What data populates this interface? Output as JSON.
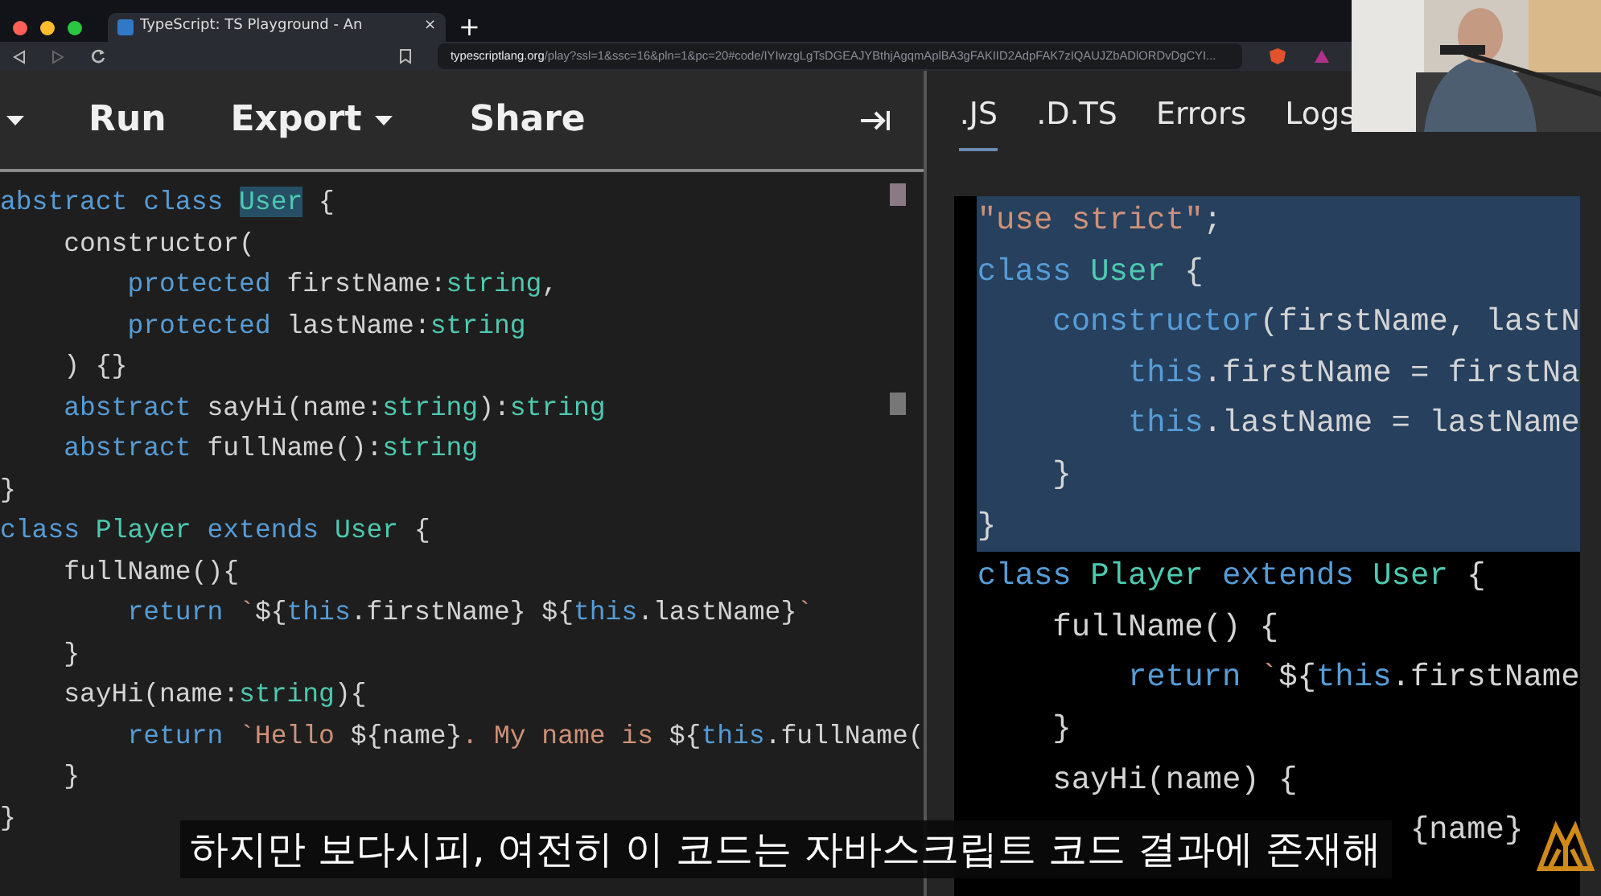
{
  "browser": {
    "tab_title": "TypeScript: TS Playground - An",
    "tab_close": "×",
    "new_tab": "+",
    "url_host": "typescriptlang.org",
    "url_path": "/play?ssl=1&ssc=16&pln=1&pc=20#code/IYIwzgLgTsDGEAJYBthjAgqmAplBA3gFAKIID2AdpFAK7zIQAUJZbADlORDvDgCYI..."
  },
  "toolbar": {
    "items": [
      {
        "kind": "caret"
      },
      {
        "kind": "text",
        "label": "Run"
      },
      {
        "kind": "dropdown",
        "label": "Export"
      },
      {
        "kind": "text",
        "label": "Share"
      }
    ]
  },
  "editor_lines": [
    {
      "tokens": [
        {
          "kind": "kw",
          "text": "abstract class "
        },
        {
          "kind": "match",
          "text": "User"
        },
        {
          "kind": "plain",
          "text": " {"
        }
      ]
    },
    {
      "tokens": [
        {
          "kind": "plain",
          "text": "    constructor("
        }
      ]
    },
    {
      "tokens": [
        {
          "kind": "kw",
          "text": "        protected "
        },
        {
          "kind": "plain",
          "text": "firstName:"
        },
        {
          "kind": "type",
          "text": "string"
        },
        {
          "kind": "plain",
          "text": ","
        }
      ]
    },
    {
      "tokens": [
        {
          "kind": "kw",
          "text": "        protected "
        },
        {
          "kind": "plain",
          "text": "lastName:"
        },
        {
          "kind": "type",
          "text": "string"
        }
      ]
    },
    {
      "tokens": [
        {
          "kind": "plain",
          "text": "    ) {}"
        }
      ]
    },
    {
      "tokens": [
        {
          "kind": "kw",
          "text": "    abstract "
        },
        {
          "kind": "plain",
          "text": "sayHi(name:"
        },
        {
          "kind": "type",
          "text": "string"
        },
        {
          "kind": "plain",
          "text": "):"
        },
        {
          "kind": "type",
          "text": "string"
        }
      ]
    },
    {
      "tokens": [
        {
          "kind": "kw",
          "text": "    abstract "
        },
        {
          "kind": "plain",
          "text": "fullName():"
        },
        {
          "kind": "type",
          "text": "string"
        }
      ]
    },
    {
      "tokens": [
        {
          "kind": "plain",
          "text": "}"
        }
      ]
    },
    {
      "tokens": [
        {
          "kind": "kw",
          "text": "class "
        },
        {
          "kind": "type",
          "text": "Player "
        },
        {
          "kind": "kw",
          "text": "extends "
        },
        {
          "kind": "type",
          "text": "User"
        },
        {
          "kind": "plain",
          "text": " {"
        }
      ]
    },
    {
      "tokens": [
        {
          "kind": "plain",
          "text": "    fullName(){"
        }
      ]
    },
    {
      "tokens": [
        {
          "kind": "kw",
          "text": "        return "
        },
        {
          "kind": "str",
          "text": "`"
        },
        {
          "kind": "plain",
          "text": "${"
        },
        {
          "kind": "kw",
          "text": "this"
        },
        {
          "kind": "plain",
          "text": ".firstName} ${"
        },
        {
          "kind": "kw",
          "text": "this"
        },
        {
          "kind": "plain",
          "text": ".lastName}"
        },
        {
          "kind": "str",
          "text": "`"
        }
      ]
    },
    {
      "tokens": [
        {
          "kind": "plain",
          "text": "    }"
        }
      ]
    },
    {
      "tokens": [
        {
          "kind": "plain",
          "text": "    sayHi(name:"
        },
        {
          "kind": "type",
          "text": "string"
        },
        {
          "kind": "plain",
          "text": "){"
        }
      ]
    },
    {
      "tokens": [
        {
          "kind": "kw",
          "text": "        return "
        },
        {
          "kind": "str",
          "text": "`Hello "
        },
        {
          "kind": "plain",
          "text": "${name}"
        },
        {
          "kind": "str",
          "text": ". My name is "
        },
        {
          "kind": "plain",
          "text": "${"
        },
        {
          "kind": "kw",
          "text": "this"
        },
        {
          "kind": "plain",
          "text": ".fullName("
        }
      ]
    },
    {
      "tokens": [
        {
          "kind": "plain",
          "text": "    }"
        }
      ]
    },
    {
      "tokens": [
        {
          "kind": "plain",
          "text": "}"
        }
      ]
    }
  ],
  "output_tabs": [
    {
      "label": ".JS",
      "selected": true
    },
    {
      "label": ".D.TS",
      "selected": false
    },
    {
      "label": "Errors",
      "selected": false
    },
    {
      "label": "Logs",
      "selected": false
    }
  ],
  "output_lines": [
    {
      "selected": true,
      "tokens": [
        {
          "kind": "str",
          "text": "\"use strict\""
        },
        {
          "kind": "plain",
          "text": ";"
        }
      ]
    },
    {
      "selected": true,
      "tokens": [
        {
          "kind": "kw",
          "text": "class "
        },
        {
          "kind": "type",
          "text": "User"
        },
        {
          "kind": "plain",
          "text": " {"
        }
      ]
    },
    {
      "selected": true,
      "tokens": [
        {
          "kind": "kw",
          "text": "    constructor"
        },
        {
          "kind": "plain",
          "text": "(firstName, lastN"
        }
      ]
    },
    {
      "selected": true,
      "tokens": [
        {
          "kind": "kw",
          "text": "        this"
        },
        {
          "kind": "plain",
          "text": ".firstName = firstNa"
        }
      ]
    },
    {
      "selected": true,
      "tokens": [
        {
          "kind": "kw",
          "text": "        this"
        },
        {
          "kind": "plain",
          "text": ".lastName = lastName"
        }
      ]
    },
    {
      "selected": true,
      "tokens": [
        {
          "kind": "plain",
          "text": "    }"
        }
      ]
    },
    {
      "selected": true,
      "tokens": [
        {
          "kind": "plain",
          "text": "}"
        }
      ]
    },
    {
      "selected": false,
      "tokens": [
        {
          "kind": "kw",
          "text": "class "
        },
        {
          "kind": "type",
          "text": "Player "
        },
        {
          "kind": "kw",
          "text": "extends "
        },
        {
          "kind": "type",
          "text": "User"
        },
        {
          "kind": "plain",
          "text": " {"
        }
      ]
    },
    {
      "selected": false,
      "tokens": [
        {
          "kind": "plain",
          "text": "    fullName() {"
        }
      ]
    },
    {
      "selected": false,
      "tokens": [
        {
          "kind": "kw",
          "text": "        return "
        },
        {
          "kind": "str",
          "text": "`"
        },
        {
          "kind": "plain",
          "text": "${"
        },
        {
          "kind": "kw",
          "text": "this"
        },
        {
          "kind": "plain",
          "text": ".firstName"
        }
      ]
    },
    {
      "selected": false,
      "tokens": [
        {
          "kind": "plain",
          "text": "    }"
        }
      ]
    },
    {
      "selected": false,
      "tokens": [
        {
          "kind": "plain",
          "text": "    sayHi(name) {"
        }
      ]
    },
    {
      "selected": false,
      "kind": "tail",
      "tokens": [
        {
          "kind": "plain",
          "text": "{name}"
        }
      ]
    }
  ],
  "subtitle": "하지만 보다시피, 여전히 이 코드는 자바스크립트 코드 결과에 존재해"
}
